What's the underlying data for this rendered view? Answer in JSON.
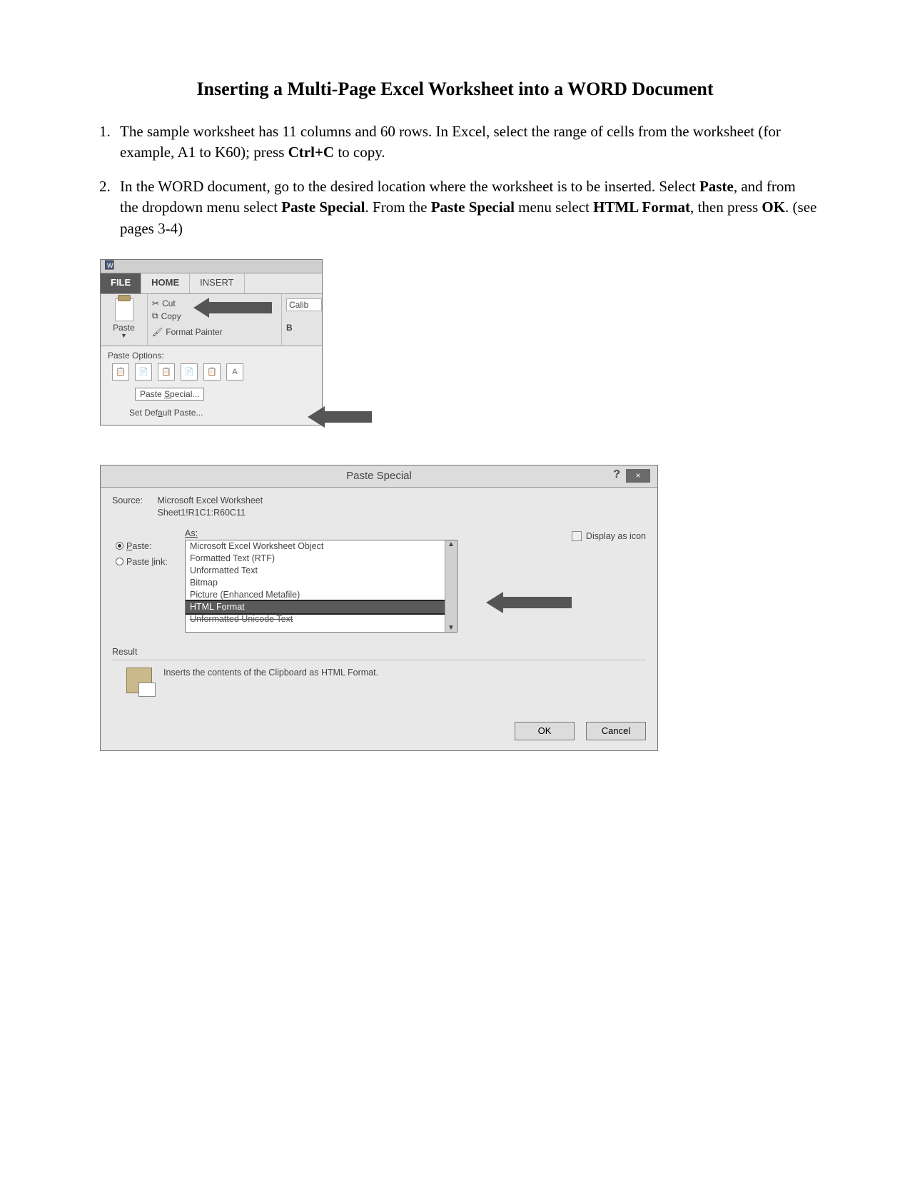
{
  "title": "Inserting a Multi-Page Excel Worksheet into a WORD Document",
  "steps": {
    "s1a": "The sample worksheet has 11 columns and 60 rows. In Excel, select the range of cells from the worksheet (for example, A1 to K60); press ",
    "s1b": "Ctrl+C",
    "s1c": " to copy.",
    "s2a": "In the WORD document, go to the desired location where the worksheet is to be inserted. Select ",
    "s2b": "Paste",
    "s2c": ", and from the dropdown menu select ",
    "s2d": "Paste Special",
    "s2e": ". From the ",
    "s2f": "Paste Special",
    "s2g": " menu select ",
    "s2h": "HTML Format",
    "s2i": ", then press ",
    "s2j": "OK",
    "s2k": ". (see pages 3-4)"
  },
  "ribbon": {
    "tab_file": "FILE",
    "tab_home": "HOME",
    "tab_insert": "INSERT",
    "paste_label": "Paste",
    "cut_label": "Cut",
    "copy_label": "Copy",
    "format_painter": "Format Painter",
    "font_box": "Calib",
    "bold_label": "B",
    "paste_options_hdr": "Paste Options:",
    "paste_special_btn": "Paste Special...",
    "set_default": "Set Default Paste..."
  },
  "dialog": {
    "title": "Paste Special",
    "help": "?",
    "close": "×",
    "source_lbl": "Source:",
    "source_line1": "Microsoft Excel Worksheet",
    "source_line2": "Sheet1!R1C1:R60C11",
    "as_lbl": "As:",
    "radio_paste": "Paste:",
    "radio_paste_link": "Paste link:",
    "opts": {
      "o1": "Microsoft Excel Worksheet Object",
      "o2": "Formatted Text (RTF)",
      "o3": "Unformatted Text",
      "o4": "Bitmap",
      "o5": "Picture (Enhanced Metafile)",
      "o6": "HTML Format",
      "o7": "Unformatted Unicode Text"
    },
    "display_as_icon": "Display as icon",
    "result_hdr": "Result",
    "result_text": "Inserts the contents of the Clipboard as HTML Format.",
    "ok": "OK",
    "cancel": "Cancel"
  }
}
